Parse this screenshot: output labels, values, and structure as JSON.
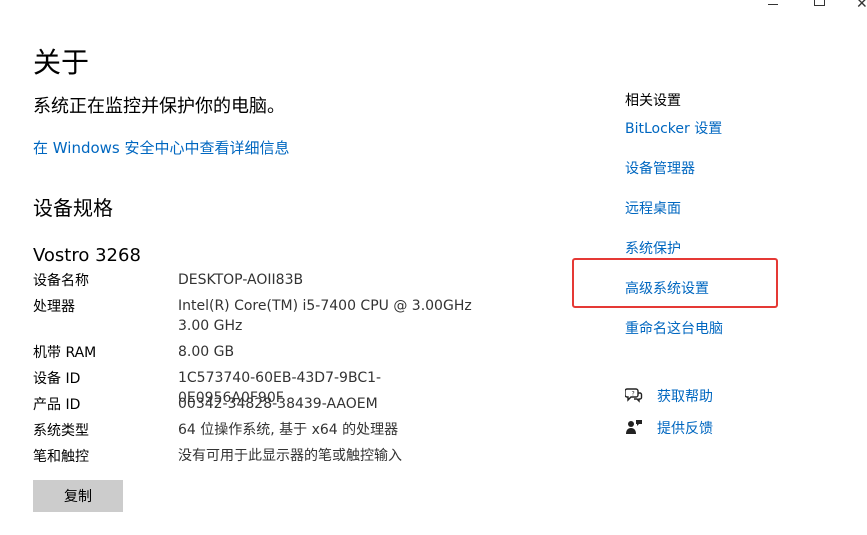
{
  "window_controls": {
    "minimize_icon": "minimize-icon",
    "maximize_icon": "maximize-icon",
    "close_icon": "close-icon"
  },
  "page": {
    "title": "关于",
    "status_text": "系统正在监控并保护你的电脑。",
    "security_link": "在 Windows 安全中心中查看详细信息",
    "specs_heading": "设备规格",
    "model": "Vostro 3268",
    "specs": [
      {
        "label": "设备名称",
        "value": "DESKTOP-AOII83B"
      },
      {
        "label": "处理器",
        "value": "Intel(R) Core(TM) i5-7400 CPU @ 3.00GHz",
        "value2": "3.00 GHz"
      },
      {
        "label": "机带 RAM",
        "value": "8.00 GB"
      },
      {
        "label": "设备 ID",
        "value": "1C573740-60EB-43D7-9BC1-0E0956A0F90F"
      },
      {
        "label": "产品 ID",
        "value": "00342-34828-38439-AAOEM"
      },
      {
        "label": "系统类型",
        "value": "64 位操作系统, 基于 x64 的处理器"
      },
      {
        "label": "笔和触控",
        "value": "没有可用于此显示器的笔或触控输入"
      }
    ],
    "copy_button": "复制"
  },
  "sidebar": {
    "title": "相关设置",
    "links": [
      "BitLocker 设置",
      "设备管理器",
      "远程桌面",
      "系统保护",
      "高级系统设置",
      "重命名这台电脑"
    ],
    "help": {
      "label": "获取帮助",
      "icon": "help-chat-icon"
    },
    "feedback": {
      "label": "提供反馈",
      "icon": "feedback-icon"
    }
  },
  "colors": {
    "link": "#0067c0",
    "highlight_border": "#e53935",
    "button_bg": "#cccccc"
  }
}
